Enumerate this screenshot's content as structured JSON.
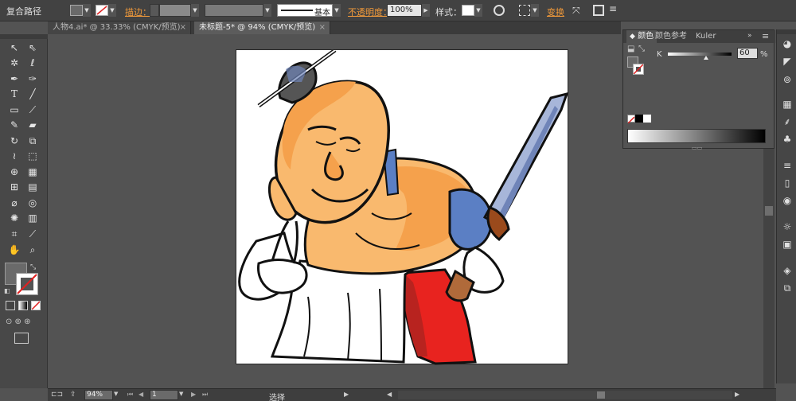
{
  "control_bar": {
    "object_type": "复合路径",
    "stroke_label": "描边：",
    "brush_value": "基本",
    "opacity_label": "不透明度：",
    "opacity_value": "100%",
    "style_label": "样式：",
    "transform_label": "变换"
  },
  "tabs": [
    {
      "label": "人物4.ai* @ 33.33% (CMYK/预览)",
      "active": false
    },
    {
      "label": "未标题-5* @ 94% (CMYK/预览)",
      "active": true
    }
  ],
  "color_panel": {
    "tabs": [
      "颜色",
      "颜色参考",
      "Kuler"
    ],
    "channel_label": "K",
    "channel_value": "60",
    "channel_unit": "%",
    "k_level_fraction": 0.6
  },
  "status_bar": {
    "zoom_value": "94%",
    "page_value": "1",
    "tool_label": "选择"
  },
  "icons": {
    "tools": [
      "selection-tool-icon",
      "direct-selection-tool-icon",
      "magic-wand-icon",
      "lasso-icon",
      "pen-tool-icon",
      "curvature-icon",
      "type-tool-icon",
      "line-tool-icon",
      "rectangle-tool-icon",
      "paintbrush-icon",
      "pencil-icon",
      "eraser-icon",
      "rotate-icon",
      "scale-icon",
      "width-tool-icon",
      "free-transform-icon",
      "shape-builder-icon",
      "perspective-grid-icon",
      "mesh-icon",
      "gradient-icon",
      "eyedropper-icon",
      "blend-icon",
      "symbol-sprayer-icon",
      "column-graph-icon",
      "artboard-tool-icon",
      "slice-tool-icon",
      "hand-tool-icon",
      "zoom-tool-icon"
    ]
  },
  "colors": {
    "skin": "#f9b96e",
    "skin_shadow": "#f5a14c",
    "pants": "#e8231f",
    "sword": "#a7b6d9",
    "sleeve": "#5b7fc4",
    "hair": "#555555",
    "accent": "#f29a3a"
  }
}
